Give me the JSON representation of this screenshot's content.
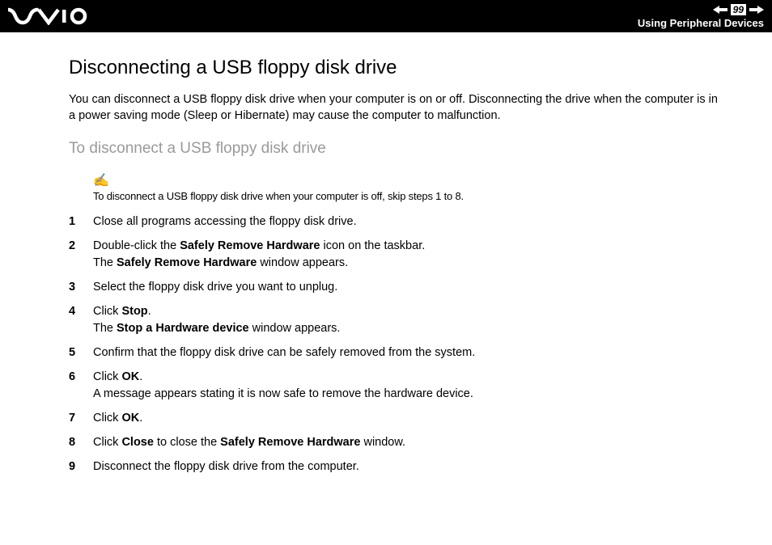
{
  "header": {
    "page_number": "99",
    "section": "Using Peripheral Devices"
  },
  "content": {
    "title": "Disconnecting a USB floppy disk drive",
    "intro": "You can disconnect a USB floppy disk drive when your computer is on or off. Disconnecting the drive when the computer is in a power saving mode (Sleep or Hibernate) may cause the computer to malfunction.",
    "subtitle": "To disconnect a USB floppy disk drive",
    "note": "To disconnect a USB floppy disk drive when your computer is off, skip steps 1 to 8.",
    "steps": [
      {
        "n": "1",
        "line1": "Close all programs accessing the floppy disk drive."
      },
      {
        "n": "2",
        "line1_a": "Double-click the ",
        "line1_b": "Safely Remove Hardware",
        "line1_c": " icon on the taskbar.",
        "line2_a": "The ",
        "line2_b": "Safely Remove Hardware",
        "line2_c": " window appears."
      },
      {
        "n": "3",
        "line1": "Select the floppy disk drive you want to unplug."
      },
      {
        "n": "4",
        "line1_a": "Click ",
        "line1_b": "Stop",
        "line1_c": ".",
        "line2_a": "The ",
        "line2_b": "Stop a Hardware device",
        "line2_c": " window appears."
      },
      {
        "n": "5",
        "line1": "Confirm that the floppy disk drive can be safely removed from the system."
      },
      {
        "n": "6",
        "line1_a": "Click ",
        "line1_b": "OK",
        "line1_c": ".",
        "line2": "A message appears stating it is now safe to remove the hardware device."
      },
      {
        "n": "7",
        "line1_a": "Click ",
        "line1_b": "OK",
        "line1_c": "."
      },
      {
        "n": "8",
        "line1_a": "Click ",
        "line1_b": "Close",
        "line1_c": " to close the ",
        "line1_d": "Safely Remove Hardware",
        "line1_e": " window."
      },
      {
        "n": "9",
        "line1": "Disconnect the floppy disk drive from the computer."
      }
    ]
  }
}
